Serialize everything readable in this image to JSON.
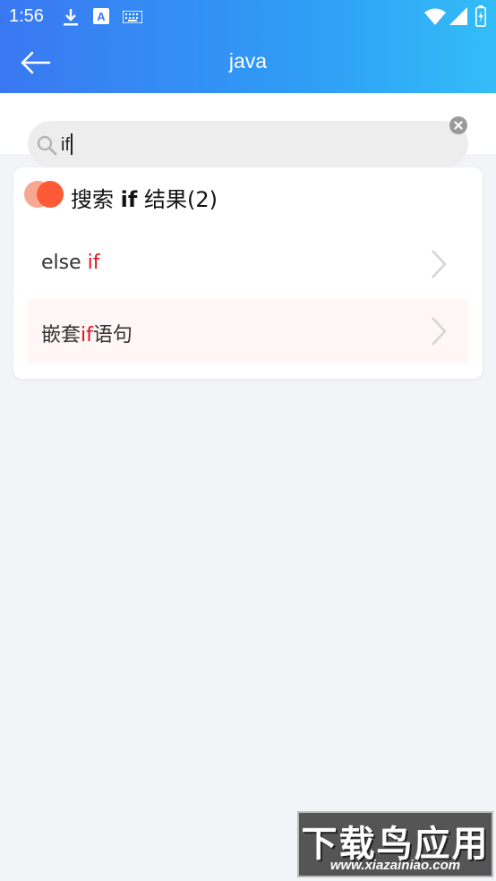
{
  "status_bar": {
    "time": "1:56",
    "icons": [
      "download-icon",
      "a-badge-icon",
      "keyboard-icon",
      "wifi-icon",
      "signal-icon",
      "battery-icon"
    ]
  },
  "toolbar": {
    "title": "java",
    "back_icon": "back-arrow-icon"
  },
  "search": {
    "value": "if",
    "icon": "search-icon",
    "clear_icon": "clear-icon"
  },
  "results": {
    "title_prefix": "搜索",
    "keyword": "if",
    "title_suffix": "结果(2)",
    "items": [
      {
        "before": "else ",
        "match": "if",
        "after": ""
      },
      {
        "before": "嵌套",
        "match": "if",
        "after": "语句"
      }
    ],
    "arrow_icon": "chevron-right-icon"
  },
  "watermark": {
    "title": "下载鸟应用",
    "url": "www.xiazainiao.com"
  },
  "colors": {
    "header_start": "#3a78f2",
    "header_end": "#33bdf8",
    "highlight": "#e0141e",
    "accent_dot": "#fe5a38",
    "background": "#f3f4f8"
  }
}
